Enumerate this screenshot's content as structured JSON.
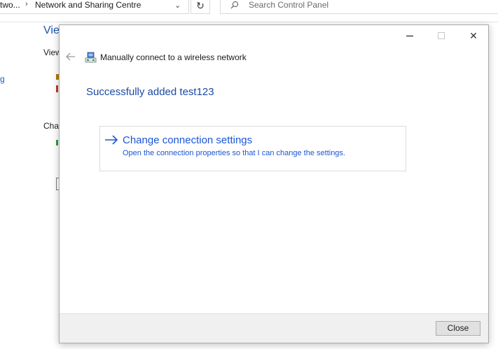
{
  "background_window": {
    "breadcrumb": [
      "two...",
      "Network and Sharing Centre"
    ],
    "breadcrumb_separator": "›",
    "search_placeholder": "Search Control Panel",
    "left_partial_texts": {
      "heading_fragment": "Vie",
      "view_fragment": "View",
      "link_fragment": "g",
      "change_fragment": "Cha"
    }
  },
  "dialog": {
    "title": "Manually connect to a wireless network",
    "heading": "Successfully added test123",
    "option": {
      "title": "Change connection settings",
      "description": "Open the connection properties so that I can change the settings."
    },
    "close_button_label": "Close",
    "window_controls": {
      "close_glyph": "✕"
    }
  },
  "colors": {
    "accent": "#1a56d6",
    "heading": "#1c4aa3",
    "footer": "#f0f0f0"
  }
}
